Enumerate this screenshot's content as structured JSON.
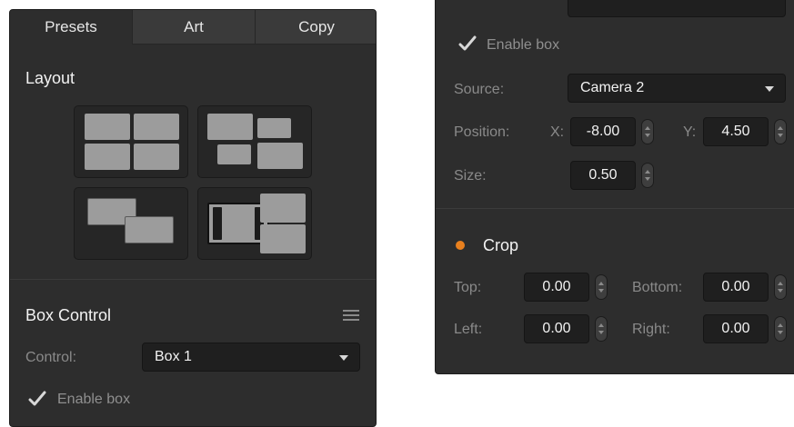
{
  "left": {
    "tabs": [
      "Presets",
      "Art",
      "Copy"
    ],
    "layout_title": "Layout",
    "box_control_title": "Box Control",
    "control_label": "Control:",
    "control_value": "Box 1",
    "enable_box_label": "Enable box"
  },
  "right": {
    "enable_box_label": "Enable box",
    "source_label": "Source:",
    "source_value": "Camera 2",
    "position_label": "Position:",
    "x_label": "X:",
    "x_value": "-8.00",
    "y_label": "Y:",
    "y_value": "4.50",
    "size_label": "Size:",
    "size_value": "0.50",
    "crop_title": "Crop",
    "top_label": "Top:",
    "top_value": "0.00",
    "bottom_label": "Bottom:",
    "bottom_value": "0.00",
    "left_label": "Left:",
    "left_value": "0.00",
    "right_label": "Right:",
    "right_value": "0.00"
  },
  "colors": {
    "panel_bg": "#2d2d2d",
    "field_bg": "#1f1f1f",
    "crop_indicator": "#e8801e",
    "checkmark": "#d8d8d8"
  }
}
